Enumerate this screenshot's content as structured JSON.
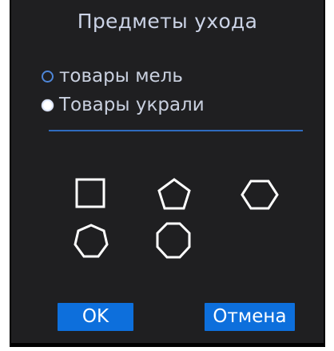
{
  "dialog": {
    "title": "Предметы ухода",
    "options": [
      {
        "label": "товары мель",
        "selected": false
      },
      {
        "label": "Товары украли",
        "selected": true
      }
    ],
    "shapes": [
      {
        "name": "square",
        "sides": 4
      },
      {
        "name": "pentagon",
        "sides": 5
      },
      {
        "name": "hexagon",
        "sides": 6
      },
      {
        "name": "heptagon",
        "sides": 7
      },
      {
        "name": "octagon",
        "sides": 8
      }
    ],
    "ok_label": "OK",
    "cancel_label": "Отмена"
  },
  "colors": {
    "background": "#1f1f21",
    "text": "#c9d0df",
    "accent": "#0d6fdc",
    "divider": "#2f6bbf"
  }
}
